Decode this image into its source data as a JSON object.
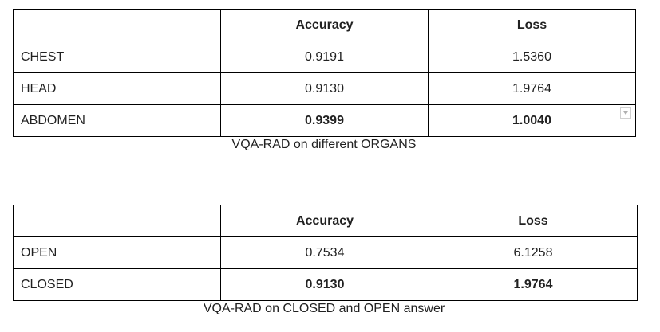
{
  "table_organs": {
    "header": [
      "",
      "Accuracy",
      "Loss"
    ],
    "rows": [
      {
        "label": "CHEST",
        "accuracy": "0.9191",
        "loss": "1.5360",
        "bold": false
      },
      {
        "label": "HEAD",
        "accuracy": "0.9130",
        "loss": "1.9764",
        "bold": false
      },
      {
        "label": "ABDOMEN",
        "accuracy": "0.9399",
        "loss": "1.0040",
        "bold": true
      }
    ],
    "caption": "VQA-RAD on different ORGANS"
  },
  "table_answers": {
    "header": [
      "",
      "Accuracy",
      "Loss"
    ],
    "rows": [
      {
        "label": "OPEN",
        "accuracy": "0.7534",
        "loss": "6.1258",
        "bold": false
      },
      {
        "label": "CLOSED",
        "accuracy": "0.9130",
        "loss": "1.9764",
        "bold": true
      }
    ],
    "caption": "VQA-RAD on CLOSED and OPEN answer"
  },
  "icons": {
    "cell_dropdown": "dropdown-arrow-icon"
  },
  "colors": {
    "border": "#000000",
    "text": "#212121"
  }
}
